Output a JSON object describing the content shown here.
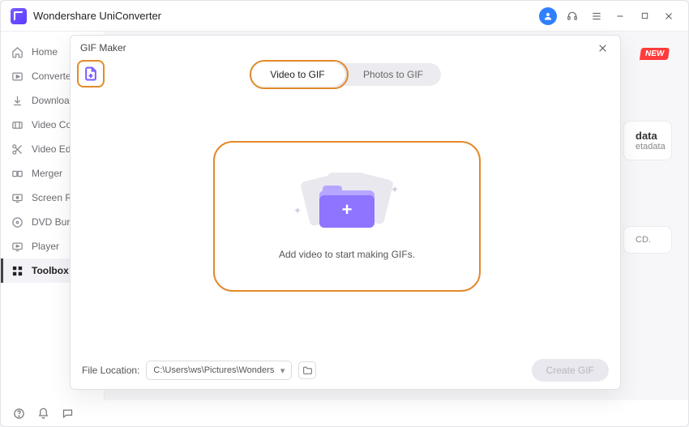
{
  "app": {
    "title": "Wondershare UniConverter"
  },
  "titlebar": {
    "user_icon": "user-icon",
    "headset_icon": "headset-icon",
    "menu_icon": "menu-icon",
    "min_icon": "minimize-icon",
    "max_icon": "maximize-icon",
    "close_icon": "close-icon"
  },
  "sidebar": {
    "items": [
      {
        "label": "Home"
      },
      {
        "label": "Converter"
      },
      {
        "label": "Downloader"
      },
      {
        "label": "Video Compressor"
      },
      {
        "label": "Video Editor"
      },
      {
        "label": "Merger"
      },
      {
        "label": "Screen Recorder"
      },
      {
        "label": "DVD Burner"
      },
      {
        "label": "Player"
      },
      {
        "label": "Toolbox"
      }
    ],
    "active_index": 9
  },
  "background": {
    "new_badge": "NEW",
    "card1_title": "data",
    "card1_sub": "etadata",
    "card2_line": "CD."
  },
  "dialog": {
    "title": "GIF Maker",
    "tabs": {
      "video": "Video to GIF",
      "photos": "Photos to GIF",
      "active": "video"
    },
    "add_icon": "add-file-icon",
    "drop_hint": "Add video to start making GIFs.",
    "footer": {
      "label": "File Location:",
      "path": "C:\\Users\\ws\\Pictures\\Wonders",
      "create_label": "Create GIF"
    }
  }
}
